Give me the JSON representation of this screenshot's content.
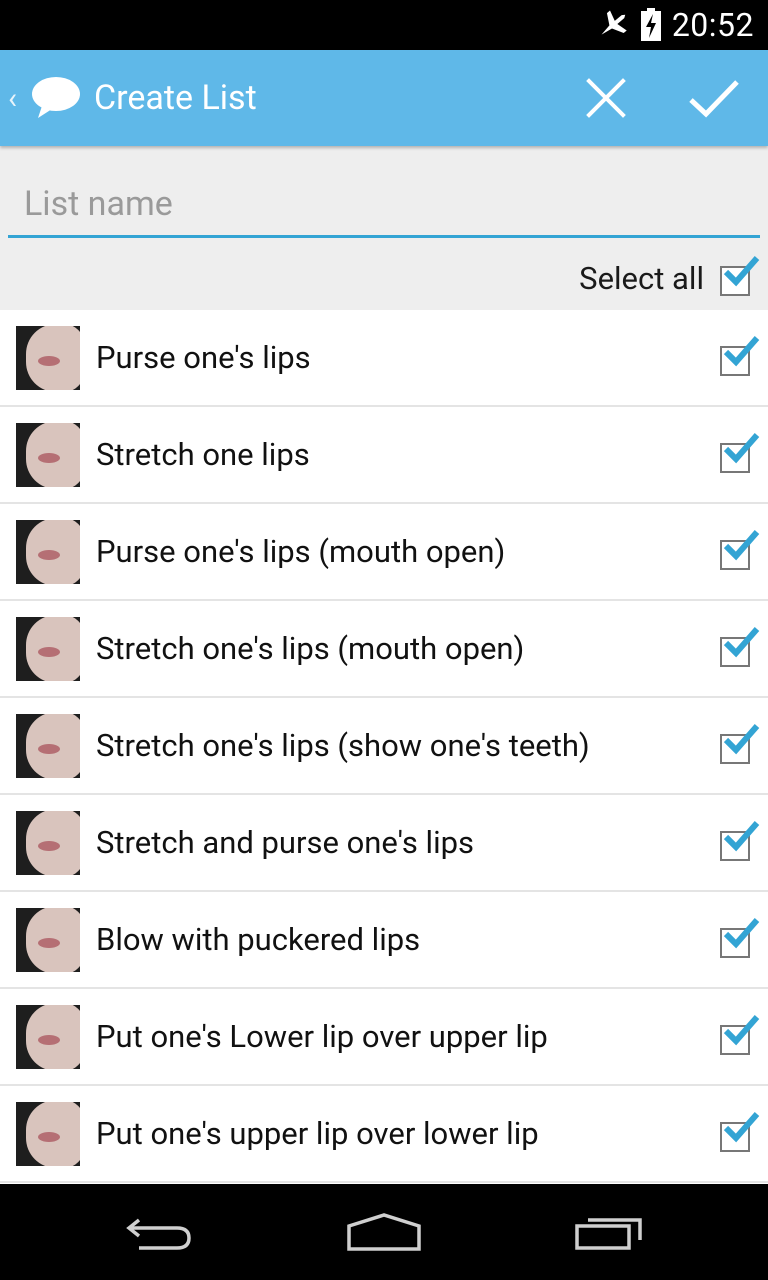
{
  "status_bar": {
    "time": "20:52",
    "icons": [
      "airplane-mode-icon",
      "battery-charging-icon"
    ]
  },
  "action_bar": {
    "title": "Create List",
    "app_icon": "speech-bubble-icon",
    "cancel_icon": "close-icon",
    "confirm_icon": "checkmark-icon"
  },
  "form": {
    "list_name_placeholder": "List name",
    "list_name_value": "",
    "select_all_label": "Select all",
    "select_all_checked": true
  },
  "items": [
    {
      "label": "Purse one's lips",
      "checked": true
    },
    {
      "label": "Stretch one lips",
      "checked": true
    },
    {
      "label": "Purse one's lips (mouth open)",
      "checked": true
    },
    {
      "label": "Stretch one's lips (mouth open)",
      "checked": true
    },
    {
      "label": "Stretch one's lips (show one's teeth)",
      "checked": true
    },
    {
      "label": "Stretch and purse one's lips",
      "checked": true
    },
    {
      "label": "Blow with puckered lips",
      "checked": true
    },
    {
      "label": "Put one's Lower lip over upper lip",
      "checked": true
    },
    {
      "label": "Put one's upper lip over lower lip",
      "checked": true
    }
  ],
  "nav_bar": {
    "buttons": [
      "back-icon",
      "home-icon",
      "recent-apps-icon"
    ]
  },
  "colors": {
    "accent": "#5fb8e8",
    "check": "#33a4d4",
    "underline": "#33a4d4"
  }
}
